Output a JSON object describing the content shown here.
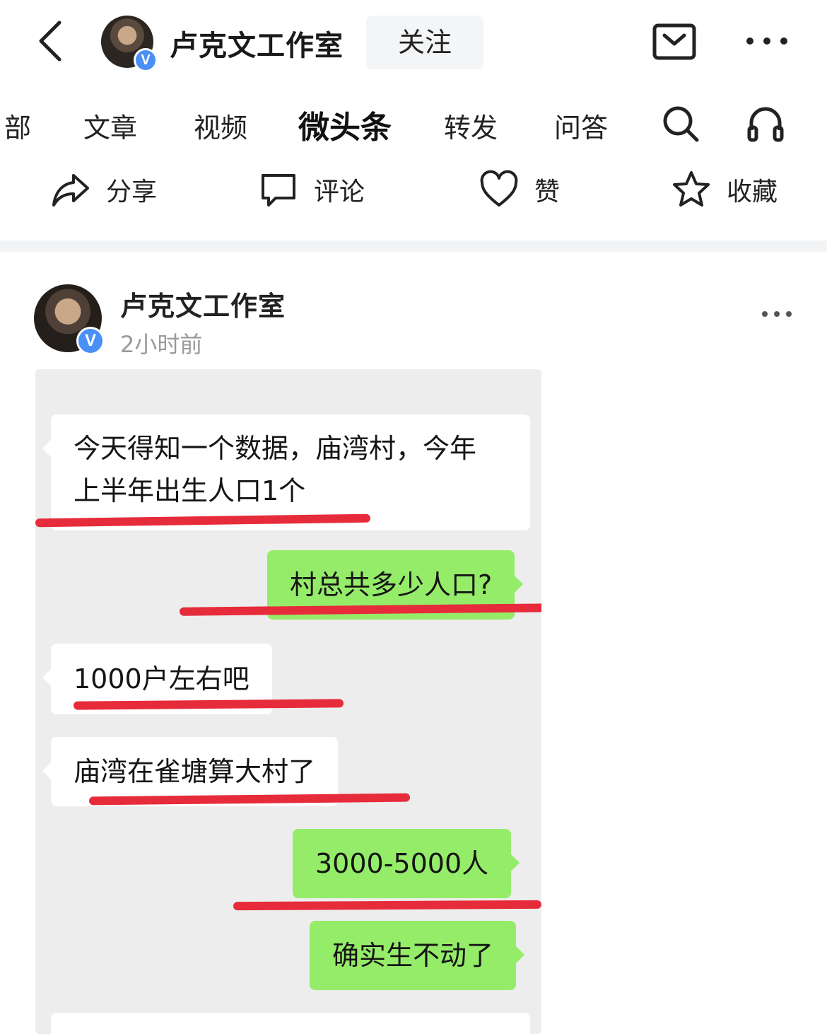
{
  "header": {
    "account_name": "卢克文工作室",
    "follow_label": "关注"
  },
  "tabs": [
    {
      "label": "部"
    },
    {
      "label": "文章"
    },
    {
      "label": "视频"
    },
    {
      "label": "微头条"
    },
    {
      "label": "转发"
    },
    {
      "label": "问答"
    }
  ],
  "actions": {
    "share": "分享",
    "comment": "评论",
    "like": "赞",
    "collect": "收藏"
  },
  "post": {
    "author": "卢克文工作室",
    "time": "2小时前",
    "verified_badge": "V"
  },
  "chat": {
    "messages": [
      {
        "side": "left",
        "line1": "今天得知一个数据，庙湾村，今年",
        "line2": "上半年出生人口1个"
      },
      {
        "side": "right",
        "text": "村总共多少人口?"
      },
      {
        "side": "left",
        "text": "1000户左右吧"
      },
      {
        "side": "left",
        "text": "庙湾在雀塘算大村了"
      },
      {
        "side": "right",
        "text": "3000-5000人"
      },
      {
        "side": "right",
        "text": "确实生不动了"
      }
    ]
  },
  "colors": {
    "accent_red": "#e62b3a",
    "bubble_green": "#95ec69",
    "verified_blue": "#4a8ff5"
  }
}
